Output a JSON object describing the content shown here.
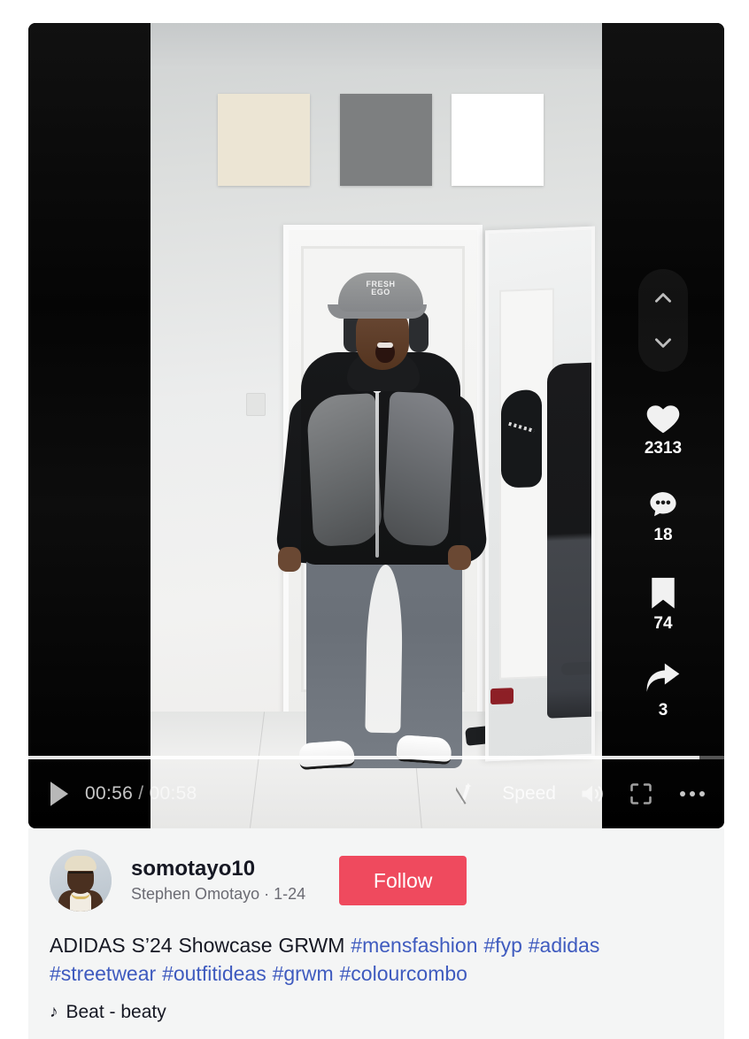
{
  "video": {
    "controls": {
      "play_icon": "play-icon",
      "current_time": "00:56",
      "separator": "/",
      "duration": "00:58",
      "progress_percent": 96.5,
      "effects_icon": "effects-off-icon",
      "speed_label": "Speed",
      "volume_icon": "volume-on-icon",
      "fullscreen_icon": "fullscreen-icon",
      "more_icon": "more-options-icon"
    },
    "navigation": {
      "previous_icon": "chevron-up-icon",
      "next_icon": "chevron-down-icon"
    },
    "actions": [
      {
        "name": "like",
        "icon": "heart-icon",
        "count": "2313"
      },
      {
        "name": "comment",
        "icon": "comment-icon",
        "count": "18"
      },
      {
        "name": "save",
        "icon": "bookmark-icon",
        "count": "74"
      },
      {
        "name": "share",
        "icon": "share-icon",
        "count": "3"
      }
    ],
    "scene": {
      "swatches": [
        {
          "label": "cream-swatch",
          "color": "#ece5d4"
        },
        {
          "label": "grey-swatch",
          "color": "#7d7f80"
        },
        {
          "label": "white-swatch",
          "color": "#ffffff"
        }
      ],
      "cap_text_line1": "FRESH",
      "cap_text_line2": "EGO"
    }
  },
  "creator": {
    "username": "somotayo10",
    "display_name_and_date": "Stephen Omotayo · 1-24",
    "follow_label": "Follow",
    "avatar_alt": "avatar"
  },
  "post": {
    "caption_text": "ADIDAS S’24 Showcase GRWM ",
    "hashtags": [
      "#mensfashion",
      "#fyp",
      "#adidas",
      "#streetwear",
      "#outfitideas",
      "#grwm",
      "#colourcombo"
    ],
    "music_note_icon": "music-note-icon",
    "music_title": "Beat - beaty"
  },
  "colors": {
    "follow_red": "#ef4a5e",
    "hashtag_blue": "#3f5bbf",
    "card_background": "#f4f5f5",
    "text_primary": "#161823"
  }
}
